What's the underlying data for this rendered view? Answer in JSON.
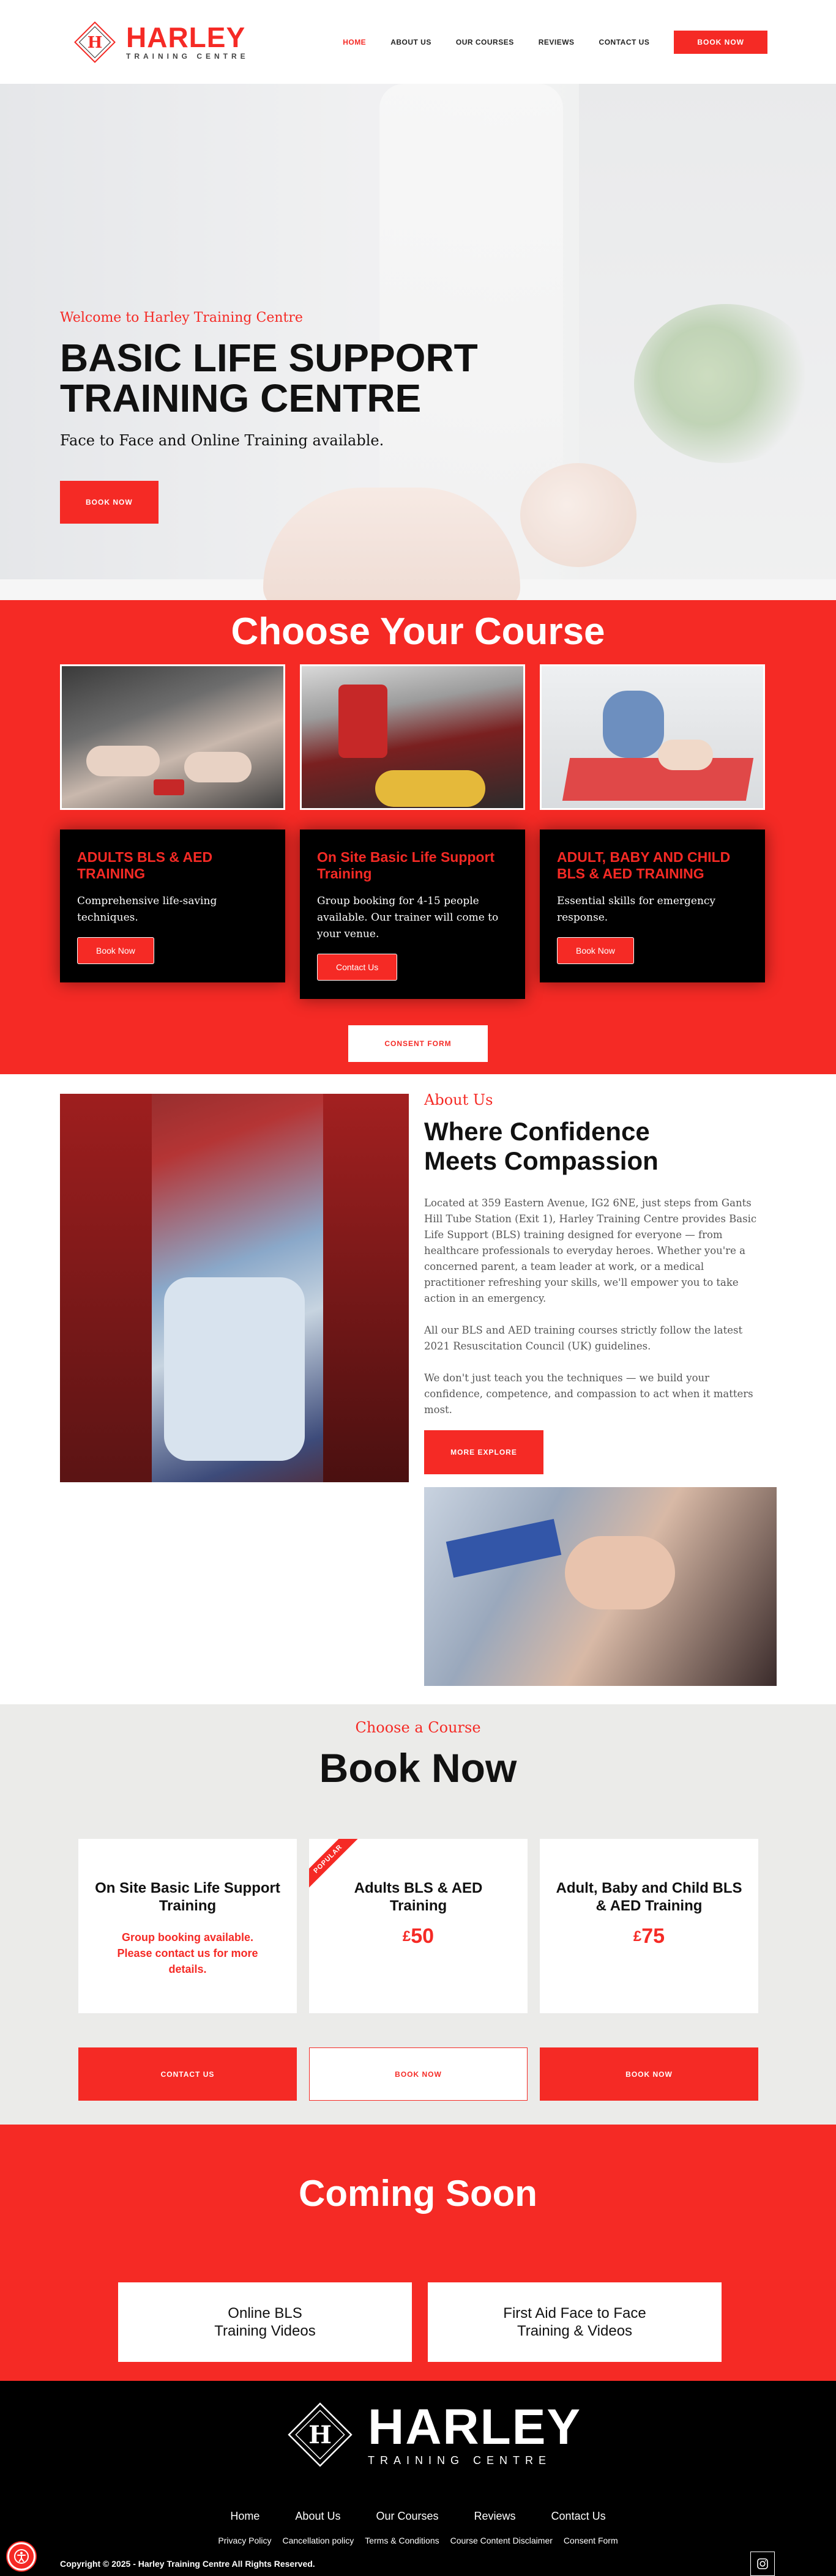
{
  "header": {
    "logo_text": "HARLEY",
    "logo_sub": "TRAINING CENTRE",
    "nav": [
      {
        "label": "HOME"
      },
      {
        "label": "ABOUT US"
      },
      {
        "label": "OUR COURSES"
      },
      {
        "label": "REVIEWS"
      },
      {
        "label": "CONTACT US"
      }
    ],
    "book_label": "BOOK NOW"
  },
  "hero": {
    "welcome": "Welcome to Harley Training Centre",
    "title_line1": "BASIC LIFE SUPPORT",
    "title_line2": "TRAINING CENTRE",
    "subtitle": "Face to Face and Online Training available.",
    "button": "BOOK NOW"
  },
  "choose": {
    "title": "Choose Your Course",
    "cards": [
      {
        "title": "ADULTS BLS & AED TRAINING",
        "text": "Comprehensive life-saving techniques.",
        "button": "Book Now"
      },
      {
        "title": "On Site Basic Life Support Training",
        "text": "Group booking for 4-15 people available. Our trainer will come to your venue.",
        "button": "Contact Us"
      },
      {
        "title": "ADULT, BABY AND CHILD BLS & AED TRAINING",
        "text": "Essential skills for emergency response.",
        "button": "Book Now"
      }
    ],
    "consent": "CONSENT FORM"
  },
  "about": {
    "kicker": "About Us",
    "title_line1": "Where Confidence",
    "title_line2": "Meets Compassion",
    "p1": "Located at 359 Eastern Avenue, IG2 6NE, just steps from Gants Hill Tube Station (Exit 1), Harley Training Centre provides Basic Life Support (BLS) training designed for everyone — from healthcare professionals to everyday heroes. Whether you're a concerned parent, a team leader at work, or a medical practitioner refreshing your skills, we'll empower you to take action in an emergency.",
    "p2": "All our BLS and AED training courses strictly follow the latest 2021 Resuscitation Council (UK) guidelines.",
    "p3": "We don't just teach you the techniques — we build your confidence, competence, and compassion to act when it matters most.",
    "button": "MORE EXPLORE"
  },
  "booknow": {
    "kicker": "Choose a Course",
    "title": "Book Now",
    "cards": [
      {
        "title": "On Site Basic Life Support Training",
        "note": "Group booking available. Please contact us for more details."
      },
      {
        "title": "Adults BLS & AED Training",
        "price_currency": "£",
        "price": "50",
        "ribbon": "POPULAR"
      },
      {
        "title": "Adult, Baby and Child BLS & AED Training",
        "price_currency": "£",
        "price": "75"
      }
    ],
    "buttons": [
      "CONTACT US",
      "BOOK NOW",
      "BOOK NOW"
    ]
  },
  "coming": {
    "title": "Coming Soon",
    "cards": [
      "Online BLS\nTraining Videos",
      "First Aid Face to Face\nTraining & Videos"
    ]
  },
  "footer": {
    "logo_text": "HARLEY",
    "logo_sub": "TRAINING CENTRE",
    "nav": [
      "Home",
      "About Us",
      "Our Courses",
      "Reviews",
      "Contact Us"
    ],
    "links": [
      "Privacy Policy",
      "Cancellation policy",
      "Terms & Conditions",
      "Course Content Disclaimer",
      "Consent Form"
    ],
    "copyright": "Copyright © 2025 - Harley Training Centre All Rights Reserved."
  },
  "colors": {
    "accent": "#f52a25",
    "dark": "#000000",
    "light_bg": "#ebebe9"
  },
  "icons": [
    "logo-diamond-icon",
    "instagram-icon",
    "accessibility-icon"
  ]
}
